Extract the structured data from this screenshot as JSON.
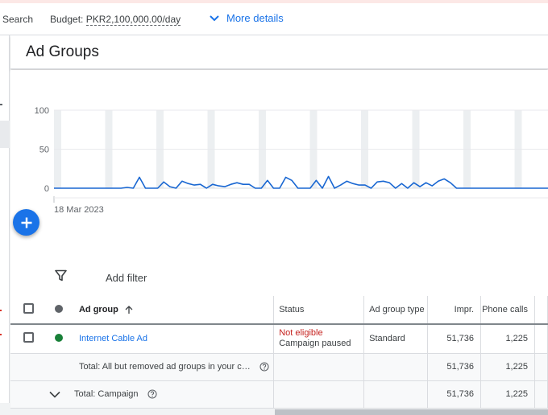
{
  "topbar": {
    "search_label": "Search",
    "budget_label": "Budget:",
    "budget_value": "PKR2,100,000.00/day",
    "more_details": "More details"
  },
  "page": {
    "title": "Ad Groups"
  },
  "colors": {
    "accent": "#1a73e8",
    "line": "#1967d2",
    "enabled_dot": "#188038",
    "not_eligible": "#c5221f"
  },
  "chart_data": {
    "type": "line",
    "x_start_label": "18 Mar 2023",
    "yticks": [
      "100",
      "50",
      "0"
    ],
    "ylim": [
      0,
      100
    ],
    "grid": true,
    "values": [
      0,
      0,
      0,
      0,
      0,
      0,
      0,
      0,
      0,
      0,
      0,
      0,
      1,
      0,
      14,
      0,
      0,
      0,
      8,
      2,
      0,
      9,
      6,
      4,
      5,
      0,
      5,
      3,
      2,
      5,
      7,
      5,
      5,
      0,
      0,
      10,
      0,
      0,
      14,
      10,
      0,
      0,
      0,
      10,
      0,
      15,
      0,
      4,
      9,
      6,
      4,
      4,
      0,
      8,
      9,
      7,
      0,
      6,
      0,
      7,
      2,
      7,
      3,
      9,
      12,
      7,
      0,
      0,
      0,
      0,
      0,
      0,
      0,
      0,
      0,
      0,
      0,
      0,
      0,
      0,
      0,
      0
    ]
  },
  "filter": {
    "add_filter": "Add filter"
  },
  "table": {
    "headers": {
      "ad_group": "Ad group",
      "status": "Status",
      "ad_group_type": "Ad group type",
      "impr": "Impr.",
      "phone_calls": "Phone calls"
    },
    "row": {
      "name": "Internet Cable Ad",
      "status_main": "Not eligible",
      "status_sub": "Campaign paused",
      "type": "Standard",
      "impr": "51,736",
      "phone_calls": "1,225"
    },
    "total_removed": {
      "label": "Total: All but removed ad groups in your c…",
      "impr": "51,736",
      "phone_calls": "1,225"
    },
    "total_campaign": {
      "label": "Total: Campaign",
      "impr": "51,736",
      "phone_calls": "1,225"
    }
  }
}
